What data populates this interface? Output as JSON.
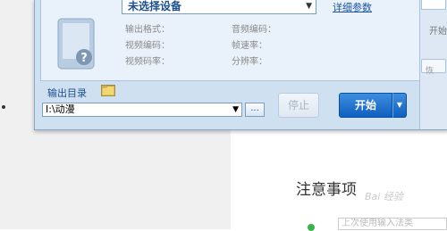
{
  "device": {
    "selected": "未选择设备",
    "details_link": "详细参数",
    "info": {
      "output_format": "输出格式：",
      "video_codec": "视频编码：",
      "video_bitrate": "视频码率：",
      "audio_codec": "音频编码：",
      "frame_rate": "帧速率：",
      "resolution": "分辨率："
    }
  },
  "output": {
    "label": "输出目录",
    "path": "I:\\动漫",
    "browse": "..."
  },
  "buttons": {
    "stop": "停止",
    "start": "开始"
  },
  "right_panel": {
    "text": "开始",
    "box_text": "恢"
  },
  "article": {
    "heading": "注意事项",
    "input_placeholder": "上次使用输入法类",
    "watermark": "Bai 经验"
  },
  "colors": {
    "accent": "#1d4f8c",
    "start_button": "#1f6fcf",
    "window_bg": "#cfe0f1"
  }
}
